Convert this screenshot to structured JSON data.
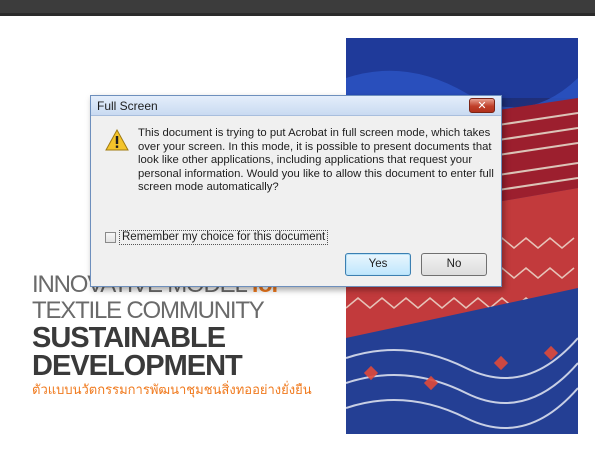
{
  "page": {
    "headline_line1_main": "INNOVATIVE MODEL ",
    "headline_line1_accent": "for",
    "headline_line2": "TEXTILE COMMUNITY",
    "headline_line3": "SUSTAINABLE",
    "headline_line4": "DEVELOPMENT",
    "thai_subtitle": "ตัวแบบนวัตกรรมการพัฒนาชุมชนสิ่งทออย่างยั่งยืน",
    "accent_color": "#f07a1e"
  },
  "dialog": {
    "title": "Full Screen",
    "close_label": "✕",
    "icon": "warning-icon",
    "message": "This document is trying to put Acrobat in full screen mode, which takes over your screen. In this mode, it is possible to present documents that look like other applications, including applications that request your personal information. Would you like to allow this document to enter full screen mode automatically?",
    "remember_label": "Remember my choice for this document",
    "remember_checked": false,
    "yes_label": "Yes",
    "no_label": "No"
  }
}
